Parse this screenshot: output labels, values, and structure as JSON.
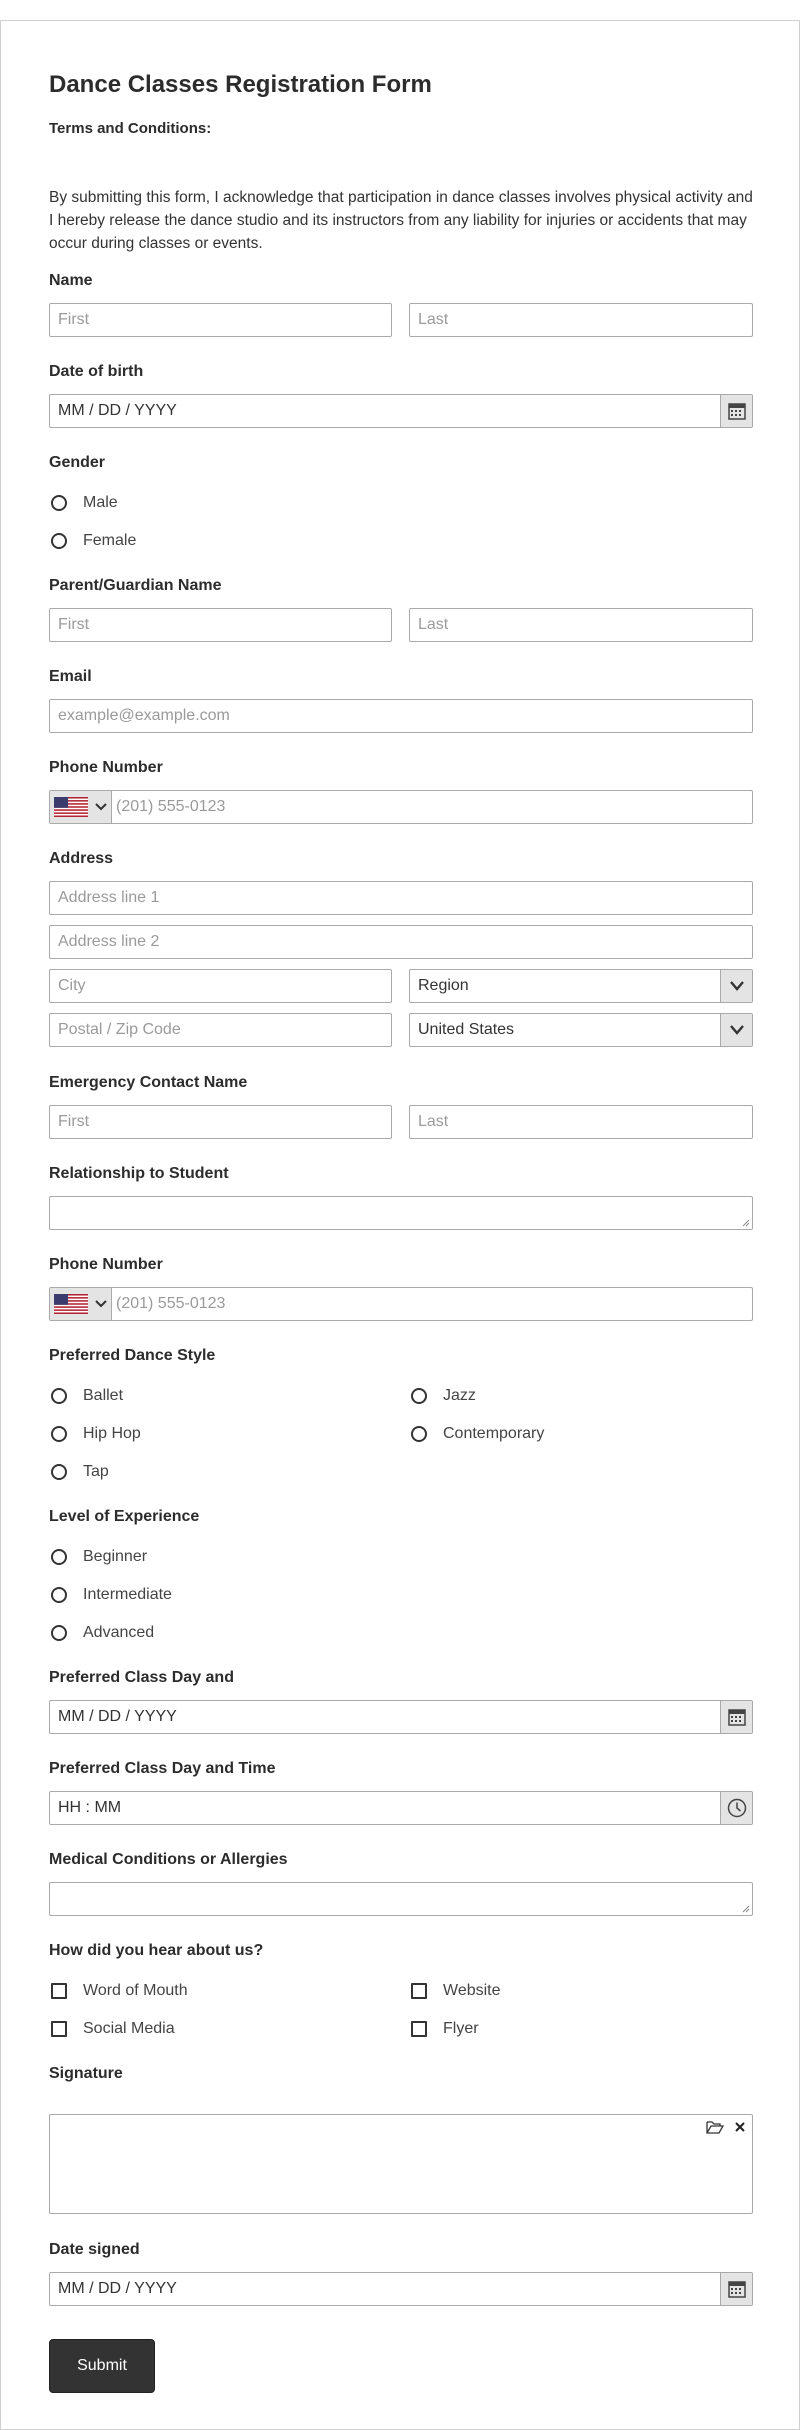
{
  "form": {
    "title": "Dance Classes Registration Form",
    "terms_label": "Terms and Conditions:",
    "terms_text": "By submitting this form, I acknowledge that participation in dance classes involves physical activity and I hereby release the dance studio and its instructors from any liability for injuries or accidents that may occur during classes or events."
  },
  "name": {
    "label": "Name",
    "first_placeholder": "First",
    "last_placeholder": "Last"
  },
  "dob": {
    "label": "Date of birth",
    "placeholder": "MM / DD / YYYY"
  },
  "gender": {
    "label": "Gender",
    "options": [
      "Male",
      "Female"
    ]
  },
  "guardian": {
    "label": "Parent/Guardian Name",
    "first_placeholder": "First",
    "last_placeholder": "Last"
  },
  "email": {
    "label": "Email",
    "placeholder": "example@example.com"
  },
  "phone": {
    "label": "Phone Number",
    "placeholder": "(201) 555-0123"
  },
  "address": {
    "label": "Address",
    "line1": "Address line 1",
    "line2": "Address line 2",
    "city": "City",
    "region": "Region",
    "postal": "Postal / Zip Code",
    "country": "United States"
  },
  "emergency": {
    "label": "Emergency Contact Name",
    "first_placeholder": "First",
    "last_placeholder": "Last"
  },
  "relationship": {
    "label": "Relationship to Student"
  },
  "phone2": {
    "label": "Phone Number",
    "placeholder": "(201) 555-0123"
  },
  "dance_style": {
    "label": "Preferred Dance Style",
    "options": [
      "Ballet",
      "Jazz",
      "Hip Hop",
      "Contemporary",
      "Tap"
    ]
  },
  "experience": {
    "label": "Level of Experience",
    "options": [
      "Beginner",
      "Intermediate",
      "Advanced"
    ]
  },
  "class_day": {
    "label": "Preferred Class Day and",
    "placeholder": "MM / DD / YYYY"
  },
  "class_time": {
    "label": "Preferred Class Day and Time",
    "placeholder": "HH : MM"
  },
  "medical": {
    "label": "Medical Conditions or Allergies"
  },
  "hear": {
    "label": "How did you hear about us?",
    "options": [
      "Word of Mouth",
      "Website",
      "Social Media",
      "Flyer"
    ]
  },
  "signature": {
    "label": "Signature"
  },
  "date_signed": {
    "label": "Date signed",
    "placeholder": "MM / DD / YYYY"
  },
  "submit_label": "Submit",
  "icons": {
    "calendar": "calendar-icon",
    "clock": "clock-icon",
    "chevron": "chevron-down-icon",
    "flag": "us-flag-icon",
    "upload": "folder-open-icon",
    "clear": "close-icon"
  },
  "colors": {
    "submit_bg": "#333333",
    "border": "#a9a9a9",
    "side_bg": "#e4e4e4"
  }
}
